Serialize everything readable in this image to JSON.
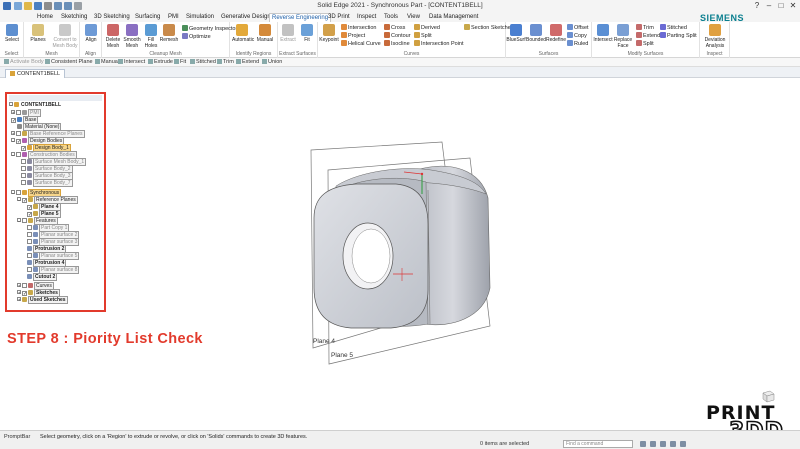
{
  "window": {
    "title": "Solid Edge 2021 - Synchronous Part - [CONTENT1BELL]",
    "brand": "SIEMENS",
    "controls": [
      "?",
      "–",
      "□",
      "✕"
    ]
  },
  "menu": {
    "tabs": [
      "Home",
      "Sketching",
      "3D Sketching",
      "Surfacing",
      "PMI",
      "Simulation",
      "Generative Design",
      "Reverse Engineering",
      "3D Print",
      "Inspect",
      "Tools",
      "View",
      "Data Management"
    ],
    "active": "Reverse Engineering"
  },
  "ribbon": {
    "select": {
      "label": "Select",
      "group": "Select"
    },
    "planes": {
      "label": "Planes"
    },
    "convert": {
      "label": "Convert to Mesh Body"
    },
    "mesh_group": "Mesh",
    "align": {
      "label": "Align",
      "group": "Align"
    },
    "cleanup": {
      "buttons": [
        "Delete Mesh",
        "Smooth Mesh",
        "Fill Holes",
        "Remesh"
      ],
      "small": [
        "Geometry Inspector",
        "Optimize"
      ],
      "group": "Cleanup Mesh"
    },
    "identify": {
      "buttons": [
        "Automatic",
        "Manual"
      ],
      "group": "Identify Regions"
    },
    "extract": {
      "buttons": [
        "Extract",
        "Fit"
      ],
      "group": "Extract Surfaces"
    },
    "keypoint": {
      "label": "Keypoint"
    },
    "curves": {
      "col1": [
        "Intersection",
        "Project",
        "Helical Curve"
      ],
      "col2": [
        "Cross",
        "Contour",
        "Isocline"
      ],
      "col3": [
        "Derived",
        "Split",
        "Intersection Point"
      ],
      "col4": [
        "Section Sketches"
      ],
      "group": "Curves"
    },
    "surfaces": {
      "buttons": [
        "BlueSurf",
        "Bounded",
        "Redefine"
      ],
      "small": [
        "Offset",
        "Copy",
        "Ruled"
      ],
      "group": "Surfaces"
    },
    "modify": {
      "buttons": [
        "Intersect",
        "Replace Face"
      ],
      "small": [
        "Trim",
        "Extend",
        "Split"
      ],
      "small2": [
        "Stitched",
        "Parting Split"
      ],
      "group": "Modify Surfaces"
    },
    "inspect": {
      "label": "Deviation Analysis",
      "group": "Inspect"
    }
  },
  "command_bar": [
    "Activate Body",
    "Consistent Plane",
    "Manual",
    "Intersect",
    "Extrude",
    "Fit",
    "Stitched",
    "Trim",
    "Extend",
    "Union"
  ],
  "document_tab": "CONTENT1BELL",
  "tree": {
    "nodes": [
      {
        "label": "CONTENT1BELL",
        "style": "bold"
      },
      {
        "label": "PMI",
        "style": "boxed dim"
      },
      {
        "label": "Base",
        "style": "boxed"
      },
      {
        "label": "Material (None)",
        "style": "boxed"
      },
      {
        "label": "Base Reference Planes",
        "style": "boxed dim"
      },
      {
        "label": "Design Bodies",
        "style": "boxed"
      },
      {
        "label": "Design Body_1",
        "style": "hl"
      },
      {
        "label": "Construction Bodies",
        "style": "boxed dim"
      },
      {
        "label": "Surface Mesh Body_1",
        "style": "boxed dim"
      },
      {
        "label": "Surface Body_2",
        "style": "boxed dim"
      },
      {
        "label": "Surface Body_3",
        "style": "boxed dim"
      },
      {
        "label": "Surface Body_7",
        "style": "boxed dim"
      },
      {
        "label": "Synchronous",
        "style": "hl"
      },
      {
        "label": "Reference Planes",
        "style": "boxed"
      },
      {
        "label": "Plane 4",
        "style": "bold boxed"
      },
      {
        "label": "Plane 5",
        "style": "bold boxed"
      },
      {
        "label": "Features",
        "style": "boxed"
      },
      {
        "label": "Part Copy 1",
        "style": "boxed dim"
      },
      {
        "label": "Planar surface 2",
        "style": "boxed dim"
      },
      {
        "label": "Planar surface 3",
        "style": "boxed dim"
      },
      {
        "label": "Protrusion 2",
        "style": "bold boxed"
      },
      {
        "label": "Planar surface 5",
        "style": "boxed dim"
      },
      {
        "label": "Protrusion 4",
        "style": "bold boxed"
      },
      {
        "label": "Planar surface 8",
        "style": "boxed dim"
      },
      {
        "label": "Cutout 2",
        "style": "bold boxed"
      },
      {
        "label": "Curves",
        "style": "boxed"
      },
      {
        "label": "Sketches",
        "style": "bold boxed"
      },
      {
        "label": "Used Sketches",
        "style": "bold boxed"
      }
    ]
  },
  "overlay": {
    "step": "STEP 8 : Piority List Check"
  },
  "viewport": {
    "plane_labels": [
      "Plane 4",
      "Plane 5"
    ]
  },
  "logo": {
    "line1": "PRINT",
    "line2": "3DD"
  },
  "status": {
    "prompt_label": "PromptBar",
    "prompt": "Select geometry, click on a 'Region' to extrude or revolve, or click on 'Solids' commands to create 3D features.",
    "selected": "0 items are selected",
    "find_placeholder": "Find a command"
  },
  "colors": {
    "accent": "#1d5fa8",
    "highlight": "#e23a2c",
    "model": "#c9ccd3"
  }
}
